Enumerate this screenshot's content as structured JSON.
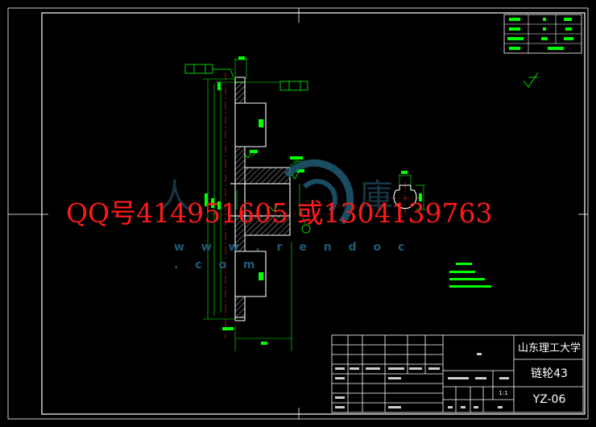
{
  "drawing": {
    "title_block": {
      "school": "山东理工大学",
      "part_name": "链轮43",
      "drawing_code": "YZ-06",
      "scale": "1:1"
    },
    "watermark": {
      "contact_text": "QQ号414951605 或1304139763",
      "url": "w w w . r e n d o c . c o m"
    },
    "colors": {
      "background": "#000000",
      "outline": "#ffffff",
      "dimension": "#00ff00",
      "centerline": "#ff2020",
      "watermark_text": "#ff1a1a",
      "watermark_logo": "#1f5a74"
    }
  }
}
